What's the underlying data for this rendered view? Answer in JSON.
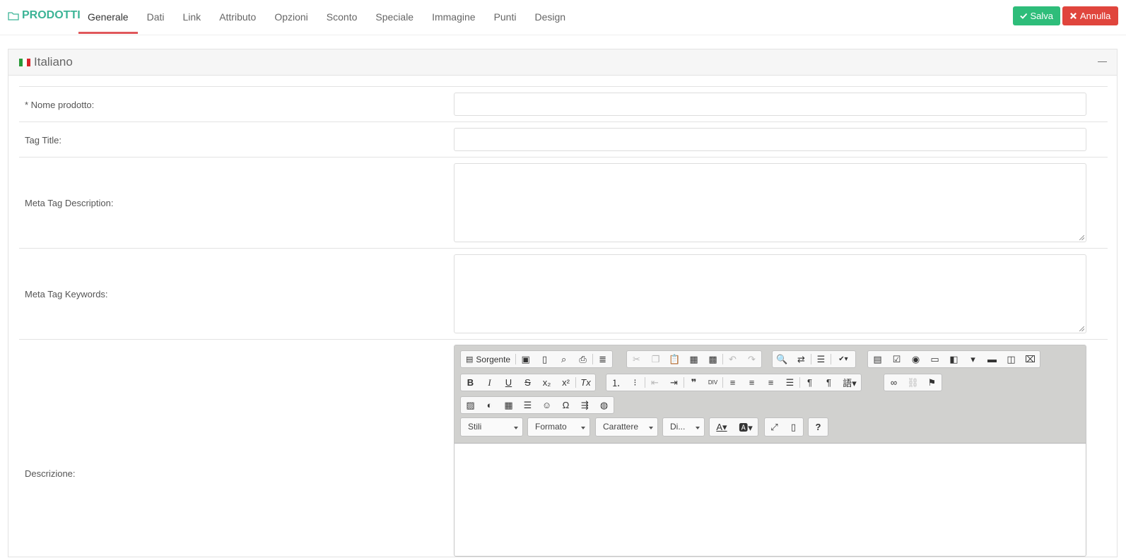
{
  "header": {
    "brand": "PRODOTTI",
    "tabs": [
      "Generale",
      "Dati",
      "Link",
      "Attributo",
      "Opzioni",
      "Sconto",
      "Speciale",
      "Immagine",
      "Punti",
      "Design"
    ],
    "active_tab": "Generale",
    "save_label": "Salva",
    "cancel_label": "Annulla",
    "colors": {
      "brand": "#3cb496",
      "save": "#2ebd7a",
      "cancel": "#e0453d",
      "active_tab_underline": "#e0575a"
    }
  },
  "panel": {
    "title": "Italiano",
    "flag_colors": [
      "#2a9a3a",
      "#ffffff",
      "#d9252b"
    ]
  },
  "form": {
    "name_label": "* Nome prodotto:",
    "name_value": "",
    "tag_title_label": "Tag Title:",
    "tag_title_value": "",
    "meta_desc_label": "Meta Tag Description:",
    "meta_desc_value": "",
    "meta_keywords_label": "Meta Tag Keywords:",
    "meta_keywords_value": "",
    "description_label": "Descrizione:"
  },
  "editor": {
    "source_label": "Sorgente",
    "styles_label": "Stili",
    "format_label": "Formato",
    "font_label": "Carattere",
    "size_label": "Di..."
  }
}
